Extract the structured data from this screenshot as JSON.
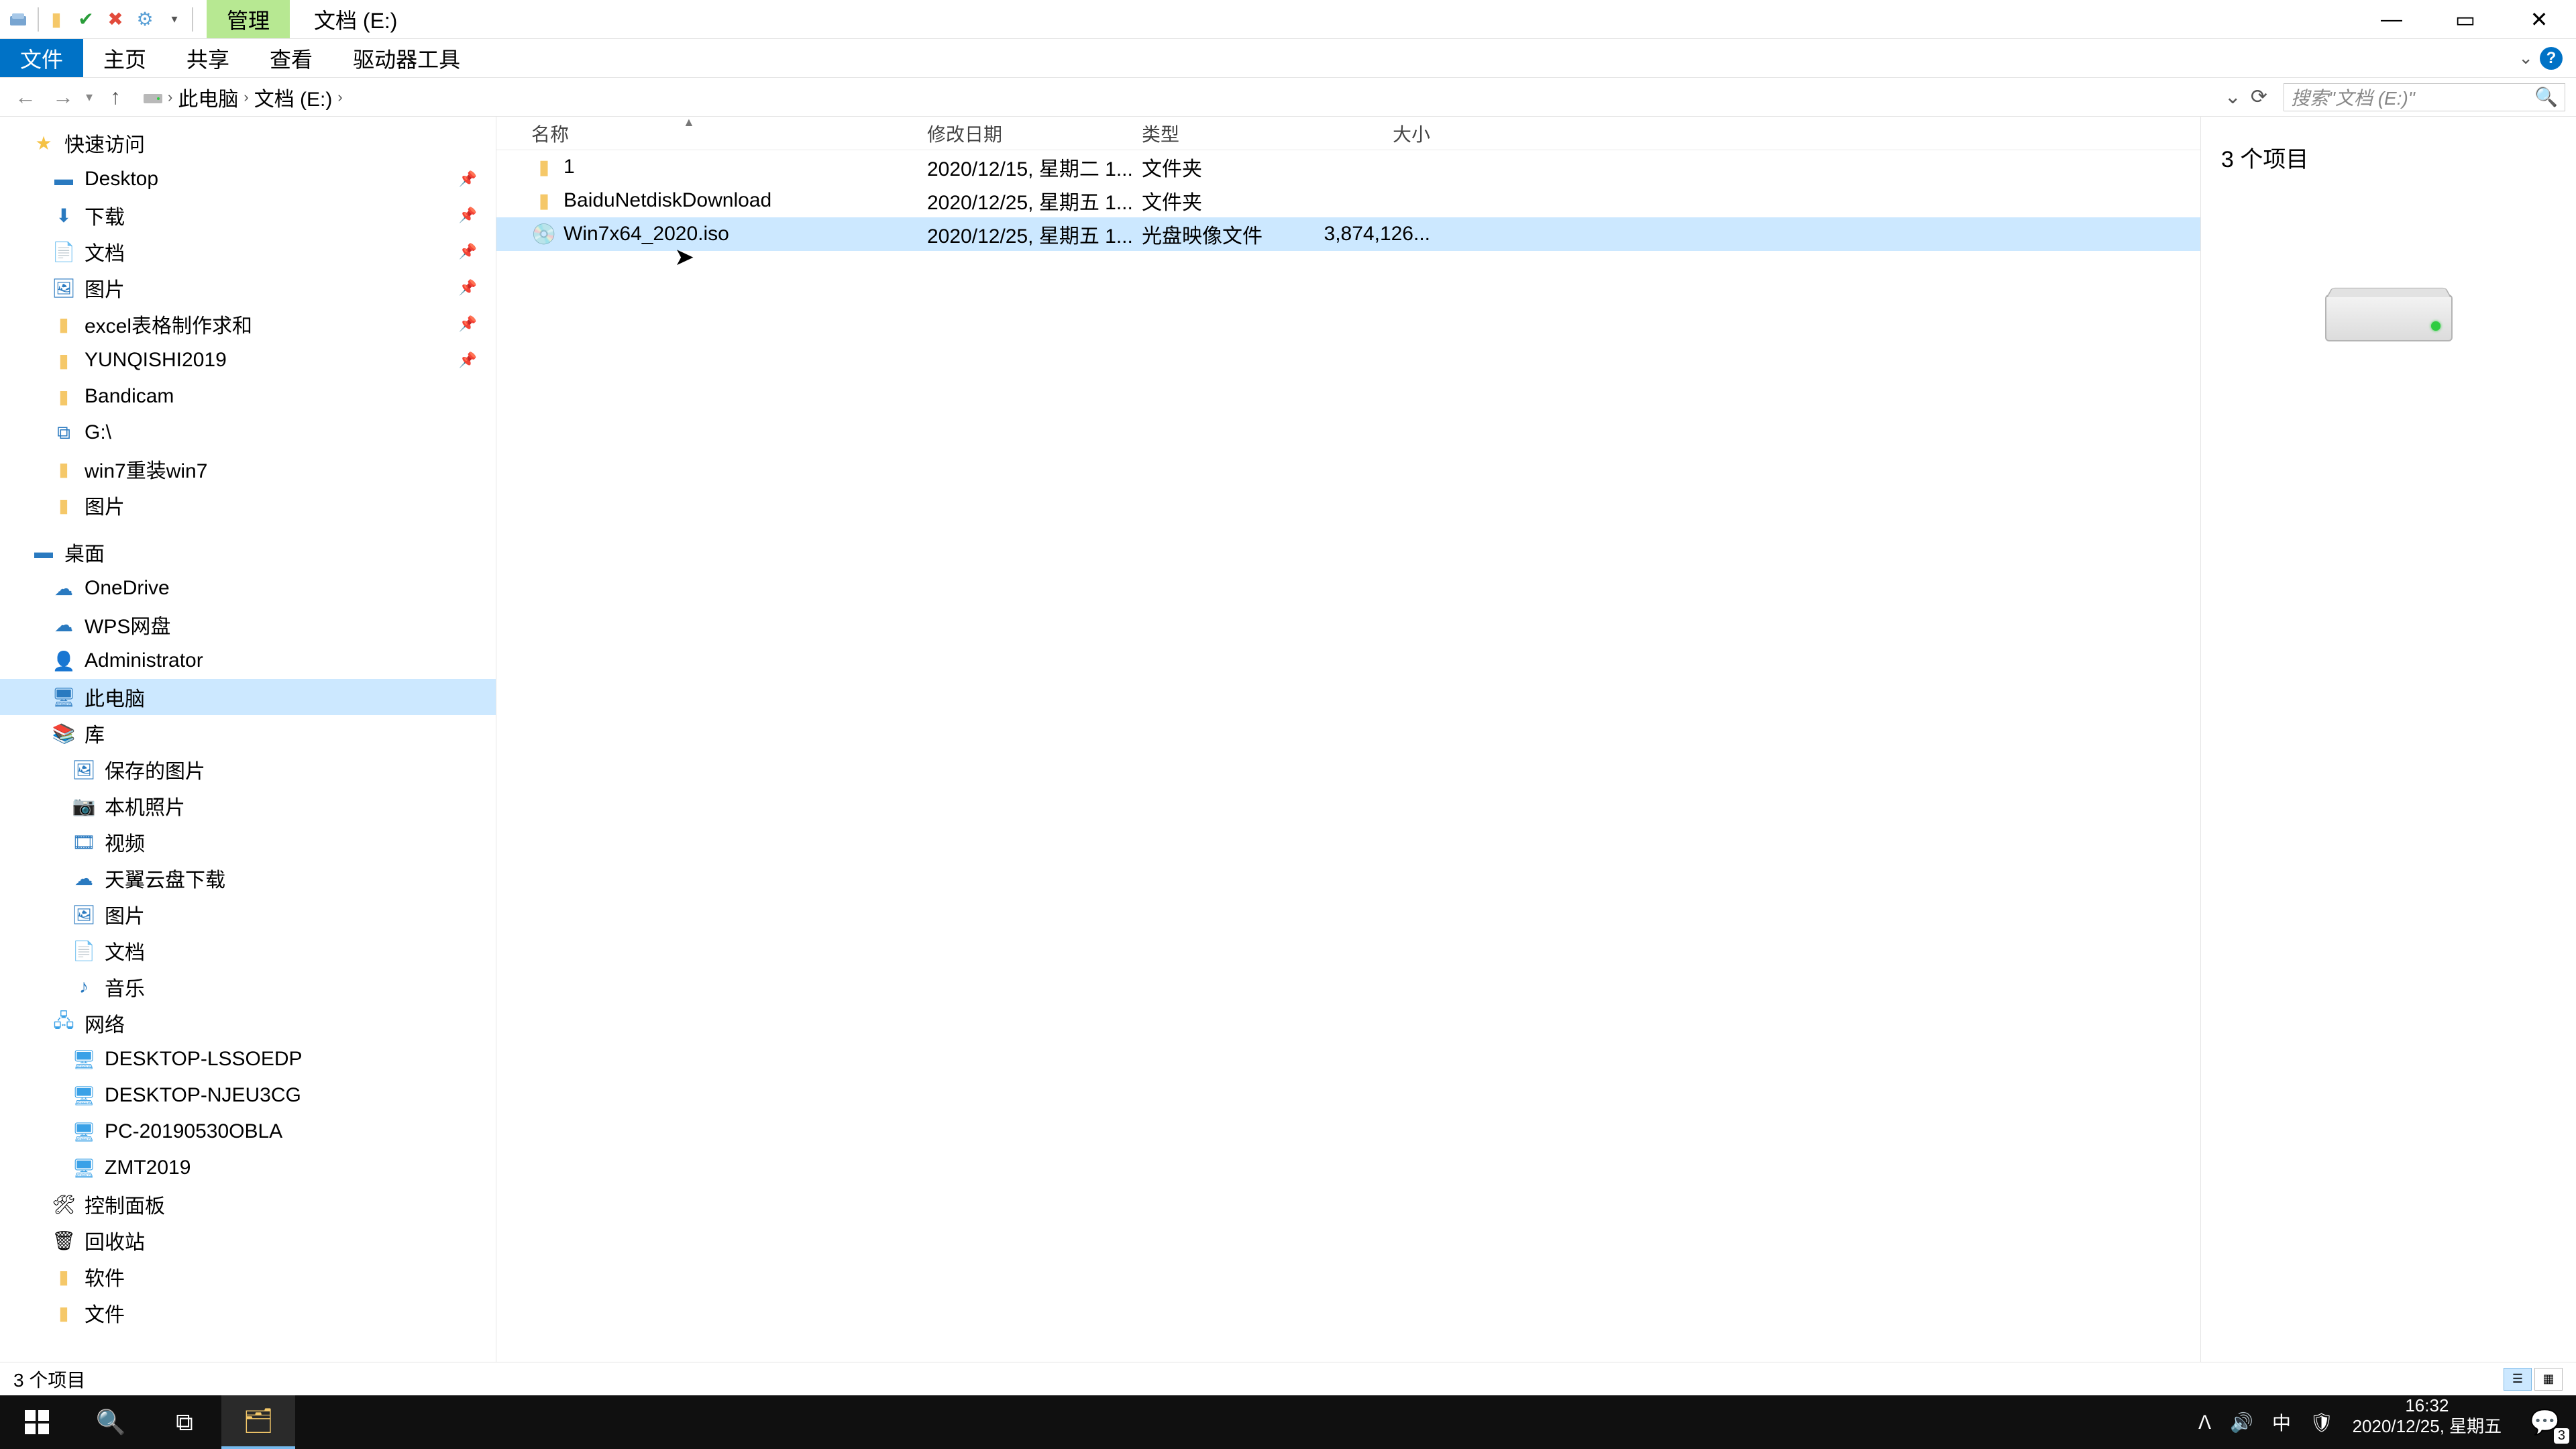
{
  "titlebar": {
    "tools_tab": "管理",
    "title": "文档 (E:)"
  },
  "ribbon": {
    "file": "文件",
    "home": "主页",
    "share": "共享",
    "view": "查看",
    "drive_tools": "驱动器工具"
  },
  "breadcrumb": {
    "seg1": "此电脑",
    "seg2": "文档 (E:)"
  },
  "search": {
    "placeholder": "搜索\"文档 (E:)\""
  },
  "tree": {
    "quick_access": "快速访问",
    "desktop_qa": "Desktop",
    "downloads": "下载",
    "documents": "文档",
    "pictures_qa": "图片",
    "excel": "excel表格制作求和",
    "yunqishi": "YUNQISHI2019",
    "bandicam": "Bandicam",
    "gdrive": "G:\\",
    "win7": "win7重装win7",
    "pictures2": "图片",
    "desktop": "桌面",
    "onedrive": "OneDrive",
    "wps": "WPS网盘",
    "admin": "Administrator",
    "thispc": "此电脑",
    "library": "库",
    "saved_pics": "保存的图片",
    "camera_roll": "本机照片",
    "videos": "视频",
    "tianyi": "天翼云盘下载",
    "pictures_lib": "图片",
    "documents_lib": "文档",
    "music_lib": "音乐",
    "network": "网络",
    "pc1": "DESKTOP-LSSOEDP",
    "pc2": "DESKTOP-NJEU3CG",
    "pc3": "PC-20190530OBLA",
    "pc4": "ZMT2019",
    "control_panel": "控制面板",
    "recycle": "回收站",
    "software": "软件",
    "files": "文件"
  },
  "columns": {
    "name": "名称",
    "date": "修改日期",
    "type": "类型",
    "size": "大小"
  },
  "files": [
    {
      "name": "1",
      "date": "2020/12/15, 星期二 1...",
      "type": "文件夹",
      "size": ""
    },
    {
      "name": "BaiduNetdiskDownload",
      "date": "2020/12/25, 星期五 1...",
      "type": "文件夹",
      "size": ""
    },
    {
      "name": "Win7x64_2020.iso",
      "date": "2020/12/25, 星期五 1...",
      "type": "光盘映像文件",
      "size": "3,874,126..."
    }
  ],
  "preview": {
    "summary": "3 个项目"
  },
  "statusbar": {
    "text": "3 个项目"
  },
  "tray": {
    "ime": "中"
  },
  "clock": {
    "time": "16:32",
    "date": "2020/12/25, 星期五"
  },
  "action_center": {
    "count": "3"
  }
}
